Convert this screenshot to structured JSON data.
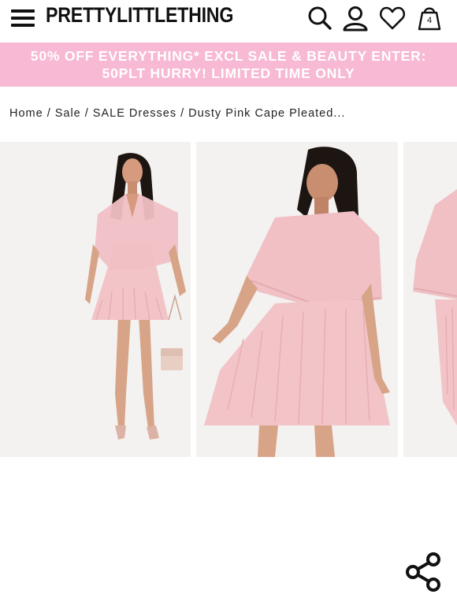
{
  "header": {
    "brand": "PRETTYLITTLETHING",
    "bag_count": "4"
  },
  "promo": {
    "line1": "50% OFF EVERYTHING* EXCL SALE & BEAUTY ENTER:",
    "line2": "50PLT HURRY! LIMITED TIME ONLY"
  },
  "breadcrumb": {
    "home": "Home",
    "sale": "Sale",
    "category": "SALE Dresses",
    "current": "Dusty Pink Cape Pleated...",
    "separator": "/"
  },
  "icons": {
    "menu": "hamburger-menu-icon",
    "search": "search-icon",
    "account": "user-icon",
    "wishlist": "heart-icon",
    "bag": "shopping-bag-icon",
    "share": "share-icon"
  },
  "colors": {
    "promo_background": "#f7b9d3",
    "promo_text": "#ffffff",
    "dress": "#f2c4c8",
    "text": "#111111"
  }
}
